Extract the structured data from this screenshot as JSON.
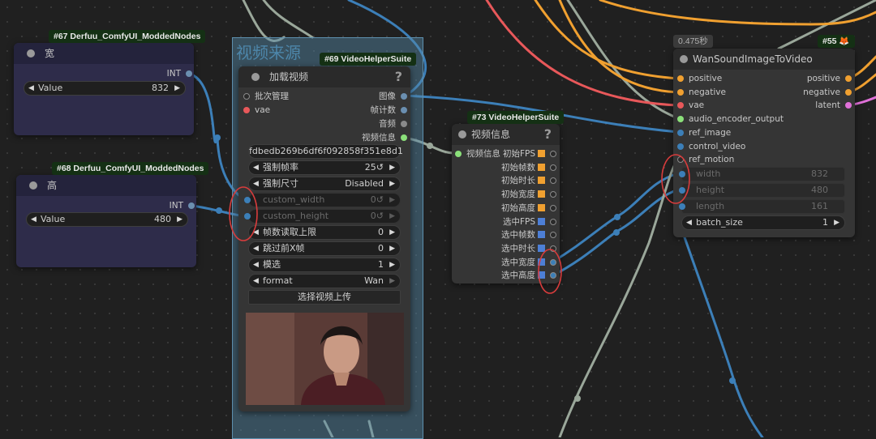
{
  "group": {
    "title": "视频来源"
  },
  "node67": {
    "badge": "#67 Derfuu_ComfyUI_ModdedNodes",
    "title": "宽",
    "output": "INT",
    "widget_label": "Value",
    "widget_value": "832"
  },
  "node68": {
    "badge": "#68 Derfuu_ComfyUI_ModdedNodes",
    "title": "高",
    "output": "INT",
    "widget_label": "Value",
    "widget_value": "480"
  },
  "node69": {
    "badge": "#69 VideoHelperSuite",
    "title": "加载视频",
    "help": "?",
    "inputs": [
      "批次管理",
      "vae"
    ],
    "outputs": [
      "图像",
      "帧计数",
      "音频",
      "视频信息"
    ],
    "video_file": "fdbedb269b6df6f092858f351e8d1 ...",
    "widgets": [
      {
        "label": "强制帧率",
        "value": "25↺"
      },
      {
        "label": "强制尺寸",
        "value": "Disabled"
      },
      {
        "label": "custom_width",
        "value": "0↺"
      },
      {
        "label": "custom_height",
        "value": "0↺"
      },
      {
        "label": "帧数读取上限",
        "value": "0"
      },
      {
        "label": "跳过前X帧",
        "value": "0"
      },
      {
        "label": "模选",
        "value": "1"
      },
      {
        "label": "format",
        "value": "Wan"
      }
    ],
    "upload_label": "选择视频上传"
  },
  "node73": {
    "badge": "#73 VideoHelperSuite",
    "title": "视频信息",
    "help": "?",
    "input": "视频信息",
    "outputs": [
      "初始FPS",
      "初始帧数",
      "初始时长",
      "初始宽度",
      "初始高度",
      "选中FPS",
      "选中帧数",
      "选中时长",
      "选中宽度",
      "选中高度"
    ]
  },
  "node55": {
    "time": "0.475秒",
    "badge": "#55 🦊",
    "title": "WanSoundImageToVideo",
    "inputs": [
      "positive",
      "negative",
      "vae",
      "audio_encoder_output",
      "ref_image",
      "control_video",
      "ref_motion"
    ],
    "outputs": [
      "positive",
      "negative",
      "latent"
    ],
    "converted_widgets": [
      {
        "label": "width",
        "value": "832"
      },
      {
        "label": "height",
        "value": "480"
      },
      {
        "label": "length",
        "value": "161"
      }
    ],
    "batch_label": "batch_size",
    "batch_value": "1"
  },
  "colors": {
    "wire_blue": "#3c7fb8",
    "wire_grey": "#9aa79a",
    "wire_orange": "#f0a030",
    "wire_red": "#e8585a",
    "wire_pink": "#e070d8",
    "annotation": "#d83c3c",
    "int_slot": "#f0a030",
    "float_slot": "#4d7fd6"
  }
}
